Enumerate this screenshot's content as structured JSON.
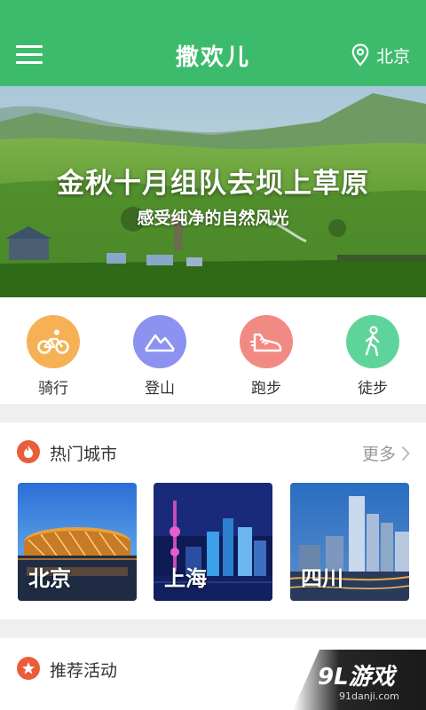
{
  "header": {
    "title": "撒欢儿",
    "location": "北京",
    "menu_icon": "menu-icon",
    "location_icon": "location-pin-icon",
    "color": "#3dbb6c"
  },
  "banner": {
    "title": "金秋十月组队去坝上草原",
    "subtitle": "感受纯净的自然风光"
  },
  "categories": [
    {
      "label": "骑行",
      "icon": "bicycle-icon",
      "color": "#f7b155"
    },
    {
      "label": "登山",
      "icon": "mountain-icon",
      "color": "#8c92f0"
    },
    {
      "label": "跑步",
      "icon": "running-shoe-icon",
      "color": "#f28a84"
    },
    {
      "label": "徒步",
      "icon": "walking-icon",
      "color": "#5fd49a"
    }
  ],
  "hot_cities": {
    "title": "热门城市",
    "more_label": "更多",
    "icon": "fire-icon",
    "cities": [
      {
        "name": "北京"
      },
      {
        "name": "上海"
      },
      {
        "name": "四川"
      }
    ]
  },
  "recommended": {
    "title": "推荐活动",
    "icon": "star-icon"
  },
  "watermark": {
    "text": "9L游戏",
    "sub": "91danji.com"
  }
}
